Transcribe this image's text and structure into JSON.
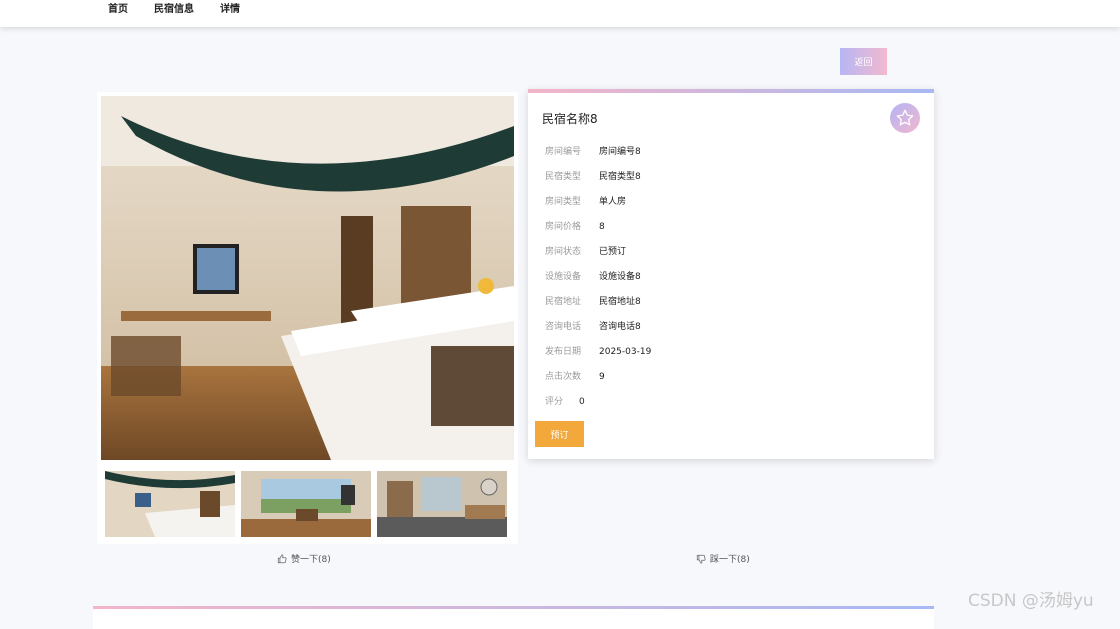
{
  "nav": {
    "items": [
      "首页",
      "民宿信息",
      "详情"
    ]
  },
  "back_label": "返回",
  "listing": {
    "title": "民宿名称8",
    "fields": [
      {
        "label": "房间编号",
        "value": "房间编号8"
      },
      {
        "label": "民宿类型",
        "value": "民宿类型8"
      },
      {
        "label": "房间类型",
        "value": "单人房"
      },
      {
        "label": "房间价格",
        "value": "8"
      },
      {
        "label": "房间状态",
        "value": "已预订"
      },
      {
        "label": "设施设备",
        "value": "设施设备8"
      },
      {
        "label": "民宿地址",
        "value": "民宿地址8"
      },
      {
        "label": "咨询电话",
        "value": "咨询电话8"
      },
      {
        "label": "发布日期",
        "value": "2025-03-19"
      },
      {
        "label": "点击次数",
        "value": "9"
      },
      {
        "label": "评分",
        "value": "0"
      }
    ],
    "book_label": "预订"
  },
  "votes": {
    "like_label": "赞一下(8)",
    "dislike_label": "踩一下(8)"
  },
  "icons": {
    "favorite": "star-icon",
    "like": "thumbs-up-icon",
    "dislike": "thumbs-down-icon"
  },
  "watermark": "CSDN @汤姆yu",
  "colors": {
    "accent_orange": "#f2a83a",
    "gradient_start": "#b7b6f4",
    "gradient_end": "#f2b9cf"
  }
}
